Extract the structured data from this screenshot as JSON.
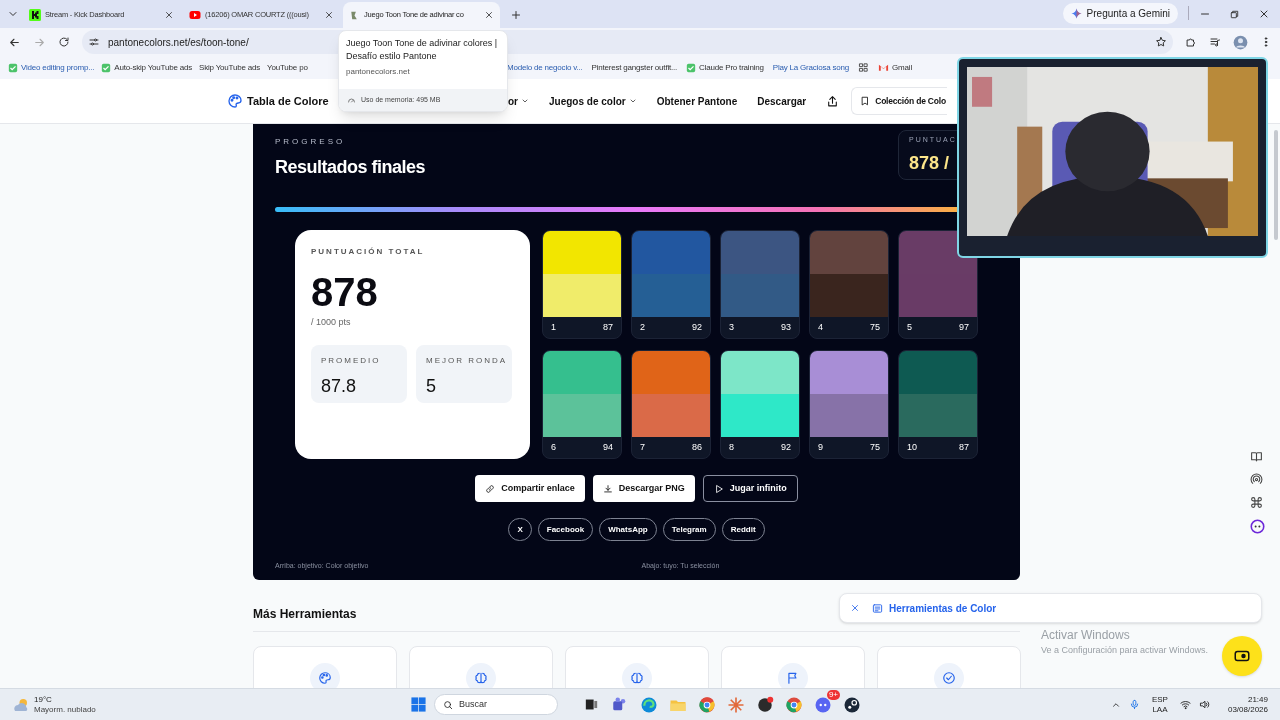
{
  "browser": {
    "tabs": [
      {
        "title": "Stream - Kick Dashboard",
        "selected": false,
        "kind": "kick"
      },
      {
        "title": "(16206) OMAR COURTZ (((ousi)",
        "selected": false,
        "kind": "video"
      },
      {
        "title": "Juego Toon Tone de adivinar co",
        "selected": true,
        "kind": "site"
      }
    ],
    "gemini_button": "Pregunta a Gemini",
    "address": "pantonecolors.net/es/toon-tone/",
    "bookmarks": [
      {
        "label": "Video editing promp...",
        "kind": "task"
      },
      {
        "label": "Auto-skip YouTube ads",
        "kind": "task"
      },
      {
        "label": "Skip YouTube ads",
        "kind": "plain"
      },
      {
        "label": "YouTube po",
        "kind": "plain"
      },
      {
        "label": "Modelo de negocio v...",
        "kind": "link"
      },
      {
        "label": "Pinterest gangster outfit...",
        "kind": "plain"
      },
      {
        "label": "Claude Pro training",
        "kind": "task"
      },
      {
        "label": "Play La Graciosa song",
        "kind": "link"
      },
      {
        "label": "Gmail",
        "kind": "mail"
      }
    ],
    "tab_tooltip": {
      "title": "Juego Toon Tone de adivinar colores | Desafío estilo Pantone",
      "domain": "pantonecolors.net",
      "memory": "Uso de memoria: 495 MB"
    }
  },
  "site_nav": {
    "logo": "Tabla de Colore",
    "items": [
      {
        "label": "or",
        "dropdown": true
      },
      {
        "label": "Juegos de color",
        "dropdown": true
      },
      {
        "label": "Obtener Pantone",
        "dropdown": false
      },
      {
        "label": "Descargar",
        "dropdown": false
      }
    ],
    "collection_button": "Colección de Colo"
  },
  "results": {
    "eyebrow": "PROGRESO",
    "title": "Resultados finales",
    "corner_card": {
      "label": "PUNTUAC",
      "value": "878 /"
    },
    "total": {
      "label": "PUNTUACIÓN TOTAL",
      "value": "878",
      "max": "/ 1000 pts"
    },
    "stats": [
      {
        "label": "PROMEDIO",
        "value": "87.8"
      },
      {
        "label": "MEJOR RONDA",
        "value": "5"
      }
    ],
    "rounds": [
      {
        "round": "1",
        "score": "87",
        "target": {
          "color": "#f2e600"
        },
        "guess": {
          "color": "#f0ec6a"
        }
      },
      {
        "round": "2",
        "score": "92",
        "target": {
          "color": "#2257a0"
        },
        "guess": {
          "color": "#255f95"
        }
      },
      {
        "round": "3",
        "score": "93",
        "target": {
          "color": "#3c5582"
        },
        "guess": {
          "color": "#325a86"
        }
      },
      {
        "round": "4",
        "score": "75",
        "target": {
          "color": "#62433e"
        },
        "guess": {
          "color": "#3a251e"
        }
      },
      {
        "round": "5",
        "score": "97",
        "target": {
          "color": "#693c66"
        },
        "guess": {
          "color": "#693b66"
        }
      },
      {
        "round": "6",
        "score": "94",
        "target": {
          "color": "#35bf8e"
        },
        "guess": {
          "color": "#5cc29a"
        }
      },
      {
        "round": "7",
        "score": "86",
        "target": {
          "color": "#e06418"
        },
        "guess": {
          "color": "#da6a48"
        }
      },
      {
        "round": "8",
        "score": "92",
        "target": {
          "color": "#7de6c8"
        },
        "guess": {
          "color": "#2ee8c8"
        }
      },
      {
        "round": "9",
        "score": "75",
        "target": {
          "color": "#a88ed6"
        },
        "guess": {
          "color": "#8772a8"
        }
      },
      {
        "round": "10",
        "score": "87",
        "target": {
          "color": "#0e5a52"
        },
        "guess": {
          "color": "#2a6a5e"
        }
      }
    ],
    "progress": {
      "level": 1
    },
    "actions": [
      {
        "label": "Compartir enlace",
        "kind": "link"
      },
      {
        "label": "Descargar PNG",
        "kind": "download"
      },
      {
        "label": "Jugar infinito",
        "kind": "play"
      }
    ],
    "share": [
      "X",
      "Facebook",
      "WhatsApp",
      "Telegram",
      "Reddit"
    ],
    "legend_top": "Arriba: objetivo: Color objetivo",
    "legend_bottom": "Abajo: tuyo: Tu selección"
  },
  "more_tools": {
    "title": "Más Herramientas",
    "cards": [
      {
        "kind": "palette"
      },
      {
        "kind": "brain"
      },
      {
        "kind": "brain"
      },
      {
        "kind": "flag"
      },
      {
        "kind": "check"
      }
    ]
  },
  "tools_bar": {
    "label": "Herramientas de Color"
  },
  "activation_notice": {
    "title": "Activar Windows",
    "text": "Ve a Configuración para activar Windows."
  },
  "taskbar": {
    "weather_temp": "19°C",
    "weather_text": "Mayorm. nublado",
    "search": "Buscar",
    "discord_badge": "9+",
    "language": "ESP",
    "layout": "LAA",
    "time": "21:49",
    "date": "03/08/2026"
  }
}
